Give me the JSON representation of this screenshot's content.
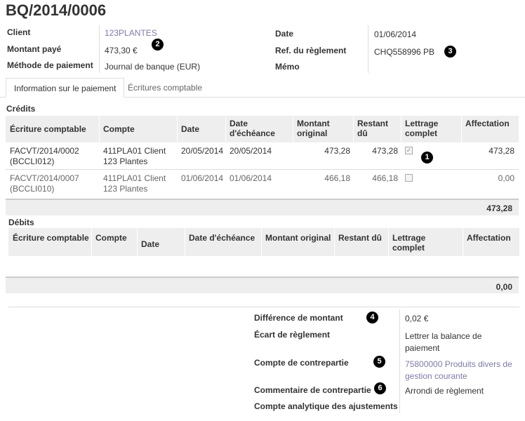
{
  "record": {
    "title": "BQ/2014/0006"
  },
  "fields": {
    "client_label": "Client",
    "client_value": "123PLANTES",
    "amount_label": "Montant payé",
    "amount_value": "473,30 €",
    "method_label": "Méthode de paiement",
    "method_value": "Journal de banque (EUR)",
    "date_label": "Date",
    "date_value": "01/06/2014",
    "ref_label": "Ref. du règlement",
    "ref_value": "CHQ558996 PB",
    "memo_label": "Mémo"
  },
  "badges": [
    "1",
    "2",
    "3",
    "4",
    "5",
    "6"
  ],
  "tabs": [
    {
      "label": "Information sur le paiement",
      "active": true
    },
    {
      "label": "Écritures comptable",
      "active": false
    }
  ],
  "credits": {
    "section_label": "Crédits",
    "headers": [
      "Écriture comptable",
      "Compte",
      "Date",
      "Date d'échéance",
      "Montant original",
      "Restant dû",
      "Lettrage complet",
      "Affectation"
    ],
    "header_lines": [
      [
        "Écriture comptable"
      ],
      [
        "Compte"
      ],
      [
        "Date"
      ],
      [
        "Date",
        "d'échéance"
      ],
      [
        "Montant",
        "original"
      ],
      [
        "Restant",
        "dû"
      ],
      [
        "Lettrage",
        "complet"
      ],
      [
        "Affectation"
      ]
    ],
    "rows": [
      {
        "entry": [
          "FACVT/2014/0002",
          "(BCCLI012)"
        ],
        "account": [
          "411PLA01 Client",
          "123 Plantes"
        ],
        "date": "20/05/2014",
        "due": "20/05/2014",
        "original": "473,28",
        "remaining": "473,28",
        "reconciled": true,
        "allocation": "473,28"
      },
      {
        "entry": [
          "FACVT/2014/0007",
          "(BCCLI010)"
        ],
        "account": [
          "411PLA01 Client",
          "123 Plantes"
        ],
        "date": "01/06/2014",
        "due": "01/06/2014",
        "original": "466,18",
        "remaining": "466,18",
        "reconciled": false,
        "allocation": "0,00"
      }
    ],
    "total": "473,28"
  },
  "debits": {
    "section_label": "Débits",
    "headers": [
      "Écriture comptable",
      "Compte",
      "Date",
      "Date d'échéance",
      "Montant original",
      "Restant dû",
      "Lettrage complet",
      "Affectation"
    ],
    "header_lines": [
      [
        "Écriture comptable"
      ],
      [
        "Compte"
      ],
      [
        "Date"
      ],
      [
        "Date d'échéance"
      ],
      [
        "Montant original"
      ],
      [
        "Restant dû"
      ],
      [
        "Lettrage",
        "complet"
      ],
      [
        "Affectation"
      ]
    ],
    "total": "0,00"
  },
  "summary": {
    "diff_label": "Différence de montant",
    "diff_value": "0,02 €",
    "writeoff_label": "Écart de règlement",
    "writeoff_value": [
      "Lettrer la balance de",
      "paiement"
    ],
    "counter_account_label": "Compte de contrepartie",
    "counter_account_value": [
      "75800000 Produits divers de",
      "gestion courante"
    ],
    "counter_comment_label": "Commentaire de contrepartie",
    "counter_comment_value": "Arrondi de règlement",
    "analytic_label": "Compte analytique des ajustements"
  }
}
